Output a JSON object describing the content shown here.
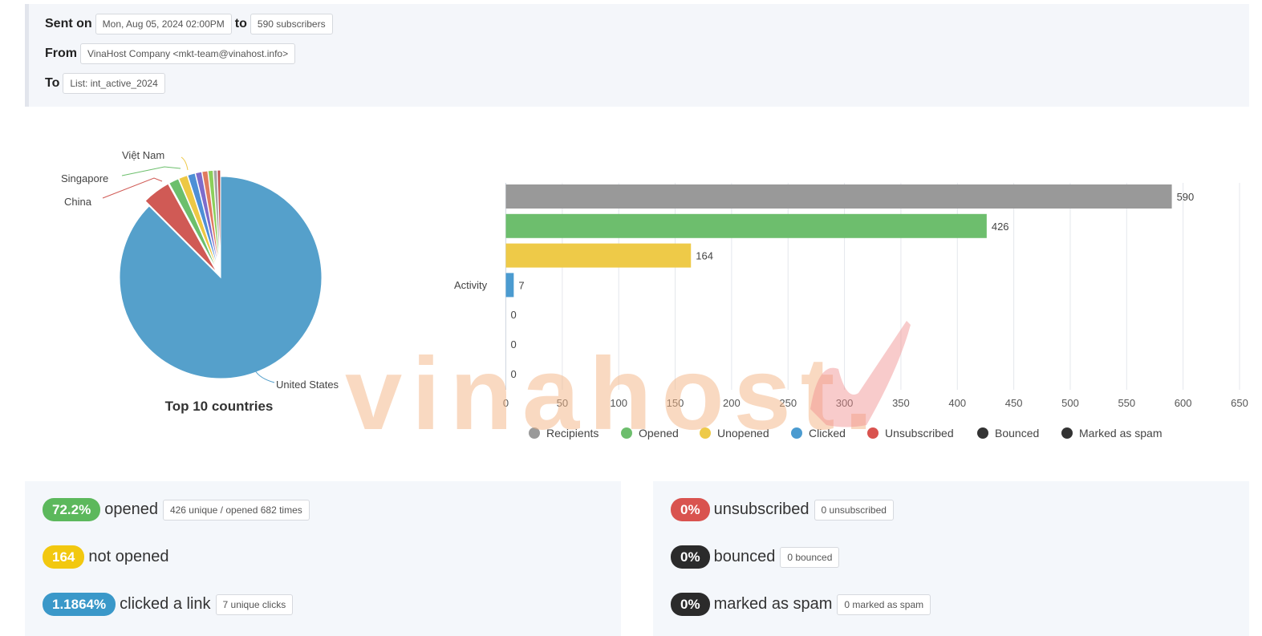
{
  "campaign": {
    "sent_on_label": "Sent on",
    "sent_on_value": "Mon, Aug 05, 2024 02:00PM",
    "to_word": "to",
    "subscribers_value": "590 subscribers",
    "from_label": "From",
    "from_value": "VinaHost Company <mkt-team@vinahost.info>",
    "to_label": "To",
    "to_value": "List: int_active_2024"
  },
  "pie_chart": {
    "title": "Top 10 countries",
    "labels": {
      "vn": "Việt Nam",
      "sg": "Singapore",
      "cn": "China",
      "us": "United States"
    }
  },
  "bar_chart": {
    "category_label": "Activity",
    "legend": [
      "Recipients",
      "Opened",
      "Unopened",
      "Clicked",
      "Unsubscribed",
      "Bounced",
      "Marked as spam"
    ]
  },
  "chart_data": [
    {
      "type": "pie",
      "title": "Top 10 countries",
      "slices": [
        {
          "label": "United States",
          "value": 87.5,
          "color": "#55a0cb"
        },
        {
          "label": "China",
          "value": 4.5,
          "color": "#d05a55"
        },
        {
          "label": "Singapore",
          "value": 1.6,
          "color": "#6cbf6c"
        },
        {
          "label": "Việt Nam",
          "value": 1.4,
          "color": "#edc844"
        },
        {
          "label": "",
          "value": 1.2,
          "color": "#4d8fd6"
        },
        {
          "label": "",
          "value": 1.0,
          "color": "#7e6ccb"
        },
        {
          "label": "",
          "value": 0.9,
          "color": "#e07a5f"
        },
        {
          "label": "",
          "value": 0.8,
          "color": "#8ccf5a"
        },
        {
          "label": "",
          "value": 0.6,
          "color": "#a5a5a5"
        },
        {
          "label": "",
          "value": 0.5,
          "color": "#c0504d"
        }
      ]
    },
    {
      "type": "bar",
      "orientation": "horizontal",
      "categories": [
        "Activity"
      ],
      "series": [
        {
          "name": "Recipients",
          "values": [
            590
          ],
          "color": "#999999"
        },
        {
          "name": "Opened",
          "values": [
            426
          ],
          "color": "#6dbe6d"
        },
        {
          "name": "Unopened",
          "values": [
            164
          ],
          "color": "#eeca48"
        },
        {
          "name": "Clicked",
          "values": [
            7
          ],
          "color": "#4b9bd0"
        },
        {
          "name": "Unsubscribed",
          "values": [
            0
          ],
          "color": "#d9534f"
        },
        {
          "name": "Bounced",
          "values": [
            0
          ],
          "color": "#333333"
        },
        {
          "name": "Marked as spam",
          "values": [
            0
          ],
          "color": "#333333"
        }
      ],
      "xlim": [
        0,
        650
      ],
      "xticks": [
        0,
        50,
        100,
        150,
        200,
        250,
        300,
        350,
        400,
        450,
        500,
        550,
        600,
        650
      ],
      "grid": true,
      "legend_position": "bottom"
    }
  ],
  "stats": {
    "opened": {
      "badge": "72.2%",
      "text": "opened",
      "detail": "426 unique / opened 682 times"
    },
    "not_opened": {
      "badge": "164",
      "text": "not opened"
    },
    "clicked": {
      "badge": "1.1864%",
      "text": "clicked a link",
      "detail": "7 unique clicks"
    },
    "unsubscribed": {
      "badge": "0%",
      "text": "unsubscribed",
      "detail": "0 unsubscribed"
    },
    "bounced": {
      "badge": "0%",
      "text": "bounced",
      "detail": "0 bounced"
    },
    "spam": {
      "badge": "0%",
      "text": "marked as spam",
      "detail": "0 marked as spam"
    }
  },
  "watermark": {
    "text": "vinahost."
  }
}
